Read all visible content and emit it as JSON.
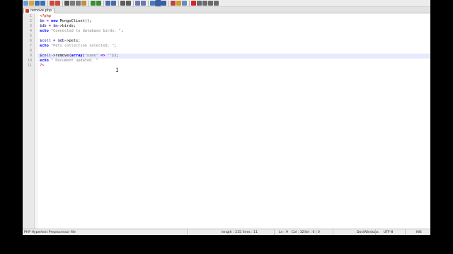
{
  "tab": {
    "filename": "remove.php"
  },
  "toolbar": {
    "icons": [
      "new-file-icon",
      "open-file-icon",
      "save-icon",
      "save-all-icon",
      "close-icon",
      "close-all-icon",
      "print-icon",
      "cut-icon",
      "copy-icon",
      "paste-icon",
      "undo-icon",
      "redo-icon",
      "find-icon",
      "replace-icon",
      "zoom-in-icon",
      "zoom-out-icon",
      "sync-vertical-icon",
      "sync-horizontal-icon",
      "word-wrap-icon",
      "show-all-chars-icon",
      "indent-guide-icon",
      "function-list-icon",
      "folder-workspace-icon",
      "monitor-icon",
      "record-macro-icon",
      "stop-macro-icon",
      "play-macro-icon",
      "run-macro-multiple-icon",
      "save-macro-icon"
    ]
  },
  "editor": {
    "line_numbers": [
      "1",
      "2",
      "3",
      "4",
      "5",
      "6",
      "7",
      "8",
      "9",
      "10",
      "11"
    ],
    "lines": [
      [
        {
          "t": "<?php",
          "c": "tag"
        }
      ],
      [
        {
          "t": "$m",
          "c": "var"
        },
        {
          "t": " = ",
          "c": "op"
        },
        {
          "t": "new",
          "c": "kw"
        },
        {
          "t": " MongoClient();",
          "c": "plain"
        }
      ],
      [
        {
          "t": "$db",
          "c": "var"
        },
        {
          "t": " = ",
          "c": "op"
        },
        {
          "t": "$m",
          "c": "var"
        },
        {
          "t": "->birds;",
          "c": "plain"
        }
      ],
      [
        {
          "t": "echo",
          "c": "kw"
        },
        {
          "t": " ",
          "c": "plain"
        },
        {
          "t": "\"Connected to database birds. \"",
          "c": "str"
        },
        {
          "t": ";",
          "c": "plain"
        }
      ],
      [],
      [
        {
          "t": "$coll",
          "c": "var"
        },
        {
          "t": " = ",
          "c": "op"
        },
        {
          "t": "$db",
          "c": "var"
        },
        {
          "t": "->pets;",
          "c": "plain"
        }
      ],
      [
        {
          "t": "echo",
          "c": "kw"
        },
        {
          "t": " ",
          "c": "plain"
        },
        {
          "t": "\"Pets collection selected. \"",
          "c": "str"
        },
        {
          "t": ";",
          "c": "plain"
        }
      ],
      [],
      [
        {
          "t": "$coll",
          "c": "var"
        },
        {
          "t": "->remove(",
          "c": "plain"
        },
        {
          "t": "array",
          "c": "kw"
        },
        {
          "t": "(",
          "c": "plain"
        },
        {
          "t": "\"name\"",
          "c": "str"
        },
        {
          "t": " => ",
          "c": "op"
        },
        {
          "t": "\"\"",
          "c": "str"
        },
        {
          "t": "));",
          "c": "plain"
        }
      ],
      [
        {
          "t": "echo",
          "c": "kw"
        },
        {
          "t": " ",
          "c": "plain"
        },
        {
          "t": "\" Document updated. \"",
          "c": "str"
        }
      ],
      [
        {
          "t": "?>",
          "c": "tag"
        }
      ]
    ],
    "current_line": 9
  },
  "statusbar": {
    "file_type": "PHP Hypertext Preprocessor file",
    "length": "length : 215",
    "lines": "lines : 11",
    "ln": "Ln : 9",
    "col": "Col : 32",
    "sel": "Sel : 0 | 0",
    "eol": "Dos\\Windows",
    "encoding": "UTF-8",
    "mode": "INS"
  },
  "colors": {
    "keyword": "#0000ff",
    "variable": "#000080",
    "string": "#808080",
    "operator": "#8000ff",
    "php_tag": "#c00000",
    "current_line": "#e8e8ff"
  }
}
